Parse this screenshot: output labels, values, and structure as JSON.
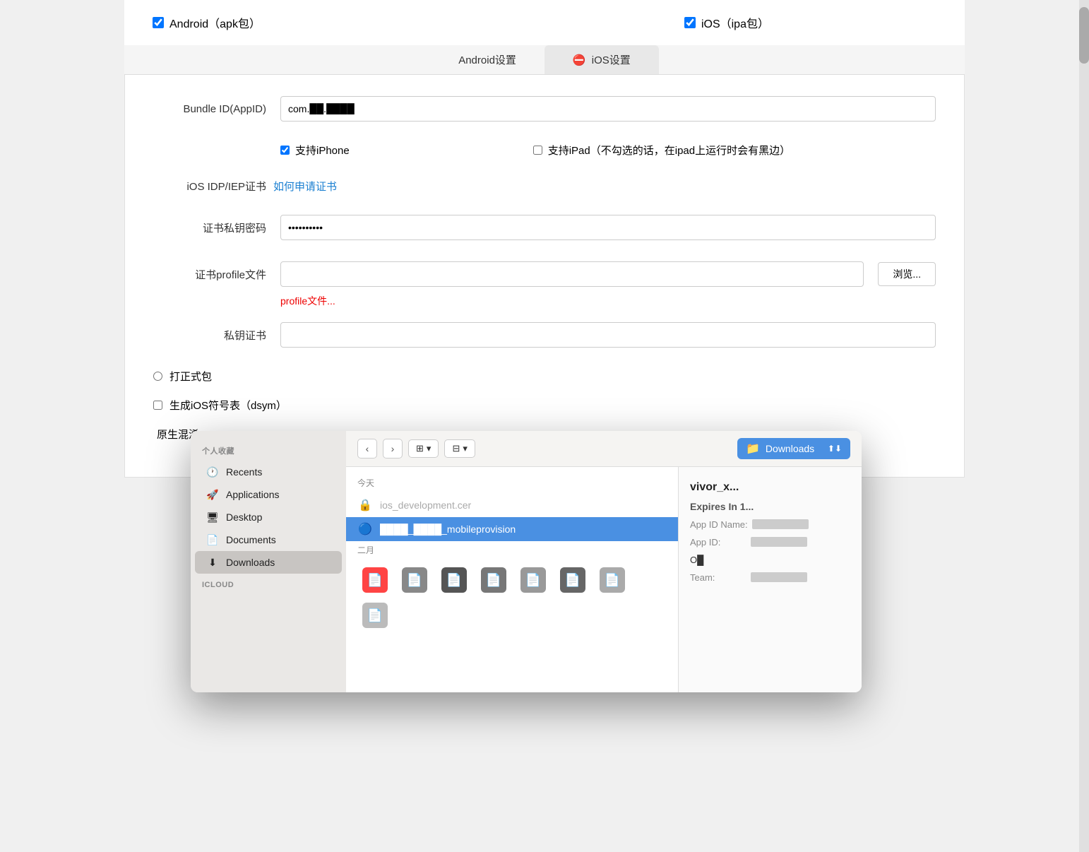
{
  "top": {
    "android_label": "Android（apk包）",
    "ios_label": "iOS（ipa包）"
  },
  "tabs": {
    "android": "Android设置",
    "ios": "iOS设置"
  },
  "form": {
    "bundle_id_label": "Bundle ID(AppID)",
    "bundle_id_value": "com.████.████",
    "support_iphone_label": "支持iPhone",
    "support_ipad_label": "支持iPad（不勾选的话，在ipad上运行时会有黑边）",
    "cert_label": "iOS IDP/IEP证书",
    "cert_link": "如何申请证书",
    "password_label": "证书私钥密码",
    "password_value": "••••••••••",
    "profile_label": "证书profile文件",
    "browse_label": "浏览...",
    "profile_hint": "profile文件...",
    "private_key_label": "私钥证书",
    "radio_formal_label": "打正式包",
    "dsym_label": "生成iOS符号表（dsym）",
    "raw_mix_label": "原生混淆"
  },
  "dialog": {
    "location": "Downloads",
    "nav_back": "‹",
    "nav_forward": "›",
    "view_columns": "⊞",
    "view_grid": "⊟",
    "sidebar": {
      "section_personal": "个人收藏",
      "items": [
        {
          "id": "recents",
          "label": "Recents",
          "icon": "🕐",
          "active": false
        },
        {
          "id": "applications",
          "label": "Applications",
          "icon": "🚀",
          "active": false
        },
        {
          "id": "desktop",
          "label": "Desktop",
          "icon": "🖥",
          "active": false
        },
        {
          "id": "documents",
          "label": "Documents",
          "icon": "📄",
          "active": false
        },
        {
          "id": "downloads",
          "label": "Downloads",
          "icon": "⬇",
          "active": true
        }
      ],
      "icloud_label": "iCloud"
    },
    "filelist": {
      "today_header": "今天",
      "files_today": [
        {
          "id": "cert",
          "name": "ios_development.cer",
          "icon": "🔒",
          "selected": false,
          "dimmed": true
        },
        {
          "id": "provision",
          "name": "████_████_mobileprovision",
          "icon": "🔵",
          "selected": true
        }
      ],
      "feb_header": "二月",
      "feb_files": [
        {
          "id": "f1",
          "icon": "📄"
        },
        {
          "id": "f2",
          "icon": "📄"
        },
        {
          "id": "f3",
          "icon": "📄"
        },
        {
          "id": "f4",
          "icon": "📄"
        },
        {
          "id": "f5",
          "icon": "📄"
        },
        {
          "id": "f6",
          "icon": "📄"
        },
        {
          "id": "f7",
          "icon": "📄"
        },
        {
          "id": "f8",
          "icon": "📄"
        }
      ]
    },
    "preview": {
      "title": "vivor_x...",
      "subtitle": "Expires In 1...",
      "app_id_name_key": "App ID Name:",
      "app_id_name_val": "██ ██",
      "app_id_key": "App ID:",
      "app_id_val": "██ ██",
      "other_key": "",
      "other_val": "O█",
      "team_key": "Team:",
      "team_val": "█ ██"
    }
  }
}
